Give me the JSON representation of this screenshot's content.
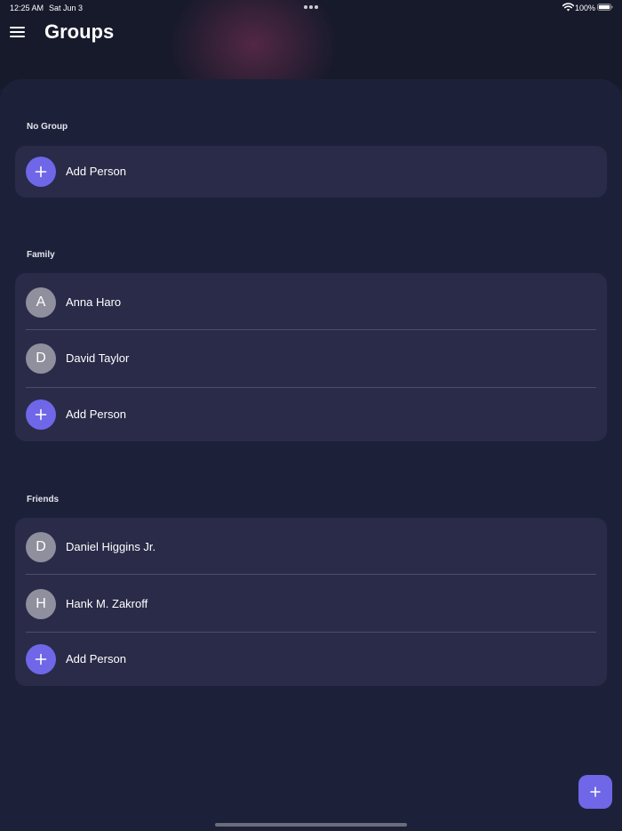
{
  "status_bar": {
    "time": "12:25 AM",
    "date": "Sat Jun 3",
    "battery_percent": "100%"
  },
  "header": {
    "title": "Groups",
    "menu_icon": "hamburger-menu-icon"
  },
  "groups": [
    {
      "label": "No Group",
      "people": [],
      "add_label": "Add Person"
    },
    {
      "label": "Family",
      "people": [
        {
          "initial": "A",
          "name": "Anna Haro"
        },
        {
          "initial": "D",
          "name": "David Taylor"
        }
      ],
      "add_label": "Add Person"
    },
    {
      "label": "Friends",
      "people": [
        {
          "initial": "D",
          "name": "Daniel Higgins Jr."
        },
        {
          "initial": "H",
          "name": "Hank M. Zakroff"
        }
      ],
      "add_label": "Add Person"
    }
  ],
  "fab": {
    "icon": "plus-icon"
  },
  "colors": {
    "accent": "#6f66e8",
    "background": "#1a1c33",
    "card": "#292b48",
    "avatar": "#8f8f9d",
    "divider": "#4b4e6b"
  }
}
